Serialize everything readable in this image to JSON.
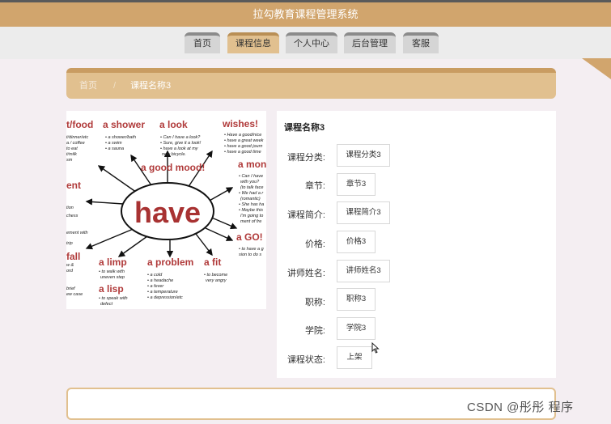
{
  "header": {
    "title": "拉勾教育课程管理系统"
  },
  "nav": {
    "items": [
      {
        "label": "首页",
        "active": false
      },
      {
        "label": "课程信息",
        "active": true
      },
      {
        "label": "个人中心",
        "active": false
      },
      {
        "label": "后台管理",
        "active": false
      },
      {
        "label": "客服",
        "active": false
      }
    ]
  },
  "breadcrumb": {
    "home": "首页",
    "sep": "/",
    "current": "课程名称3"
  },
  "image": {
    "center": "have",
    "phrases": [
      "t/food",
      "a shower",
      "a look",
      "wishes!",
      "a good mood!",
      "ent",
      "a mon",
      "a GO!",
      "fall",
      "a limp",
      "a problem",
      "a fit",
      "a lisp"
    ],
    "small": [
      "t/dinner/etc",
      "a / coffee",
      "to eat",
      "t/milk",
      "sm",
      "• a shower/bath",
      "• a swim",
      "• a sauna",
      "• Can I have a look?",
      "• Sure, give it a look!",
      "• have a look at my",
      "new bicycle.",
      "• Have a good/nice",
      "• have a great week",
      "• have a good journ",
      "• have a good time",
      "• Can I have",
      "with you?",
      "(to talk face",
      "• We had a r",
      "(romantic)",
      "• She has ha",
      "• Maybe this",
      "I'm going to",
      "ment of fre",
      "tion",
      "chess",
      "ement with",
      "trip",
      "w &",
      "ord",
      "brief",
      "ew case",
      "• to walk with",
      "uneven step",
      "• to speak with",
      "defect",
      "• a cold",
      "• a headache",
      "• a fever",
      "• a temperature",
      "• a depression/etc",
      "• to become",
      "very angry",
      "• to have a g",
      "sion to do s"
    ]
  },
  "detail": {
    "title": "课程名称3",
    "fields": [
      {
        "label": "课程分类:",
        "value": "课程分类3"
      },
      {
        "label": "章节:",
        "value": "章节3"
      },
      {
        "label": "课程简介:",
        "value": "课程简介3"
      },
      {
        "label": "价格:",
        "value": "价格3"
      },
      {
        "label": "讲师姓名:",
        "value": "讲师姓名3"
      },
      {
        "label": "职称:",
        "value": "职称3"
      },
      {
        "label": "学院:",
        "value": "学院3"
      },
      {
        "label": "课程状态:",
        "value": "上架"
      }
    ]
  },
  "watermark": "CSDN @彤彤  程序",
  "colors": {
    "brand": "#d1a56d",
    "active_tab": "#e1c08f",
    "phrase_red": "#b03a3a"
  }
}
